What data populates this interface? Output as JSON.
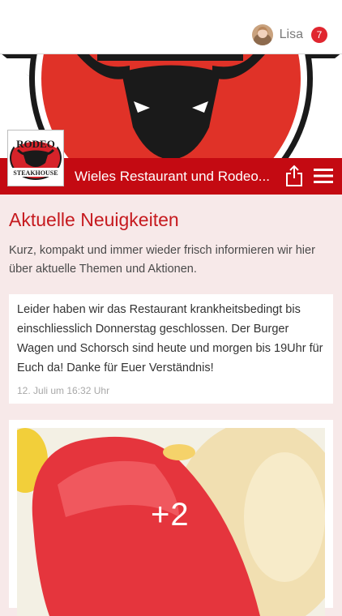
{
  "user": {
    "name": "Lisa",
    "notifications": "7"
  },
  "header": {
    "title": "Wieles Restaurant und Rodeo..."
  },
  "logo": {
    "top_text": "RODEO",
    "bottom_text": "STEAKHOUSE"
  },
  "section": {
    "title": "Aktuelle Neuigkeiten",
    "intro": "Kurz, kompakt und immer wieder frisch informieren wir hier über aktuelle Themen und Aktionen."
  },
  "posts": [
    {
      "text": "Leider haben wir das Restaurant krankheitsbedingt bis einschliesslich Donnerstag geschlossen. Der Burger Wagen und Schorsch sind heute und morgen bis 19Uhr für Euch da! Danke für Euer Verständnis!",
      "date": "12. Juli um 16:32 Uhr"
    },
    {
      "more_photos": "+2"
    }
  ],
  "colors": {
    "brand_red": "#c40a12",
    "title_red": "#c61a1f",
    "background": "#f7e9e9",
    "badge_red": "#e0262f"
  },
  "icons": [
    "share-icon",
    "hamburger-menu-icon"
  ]
}
